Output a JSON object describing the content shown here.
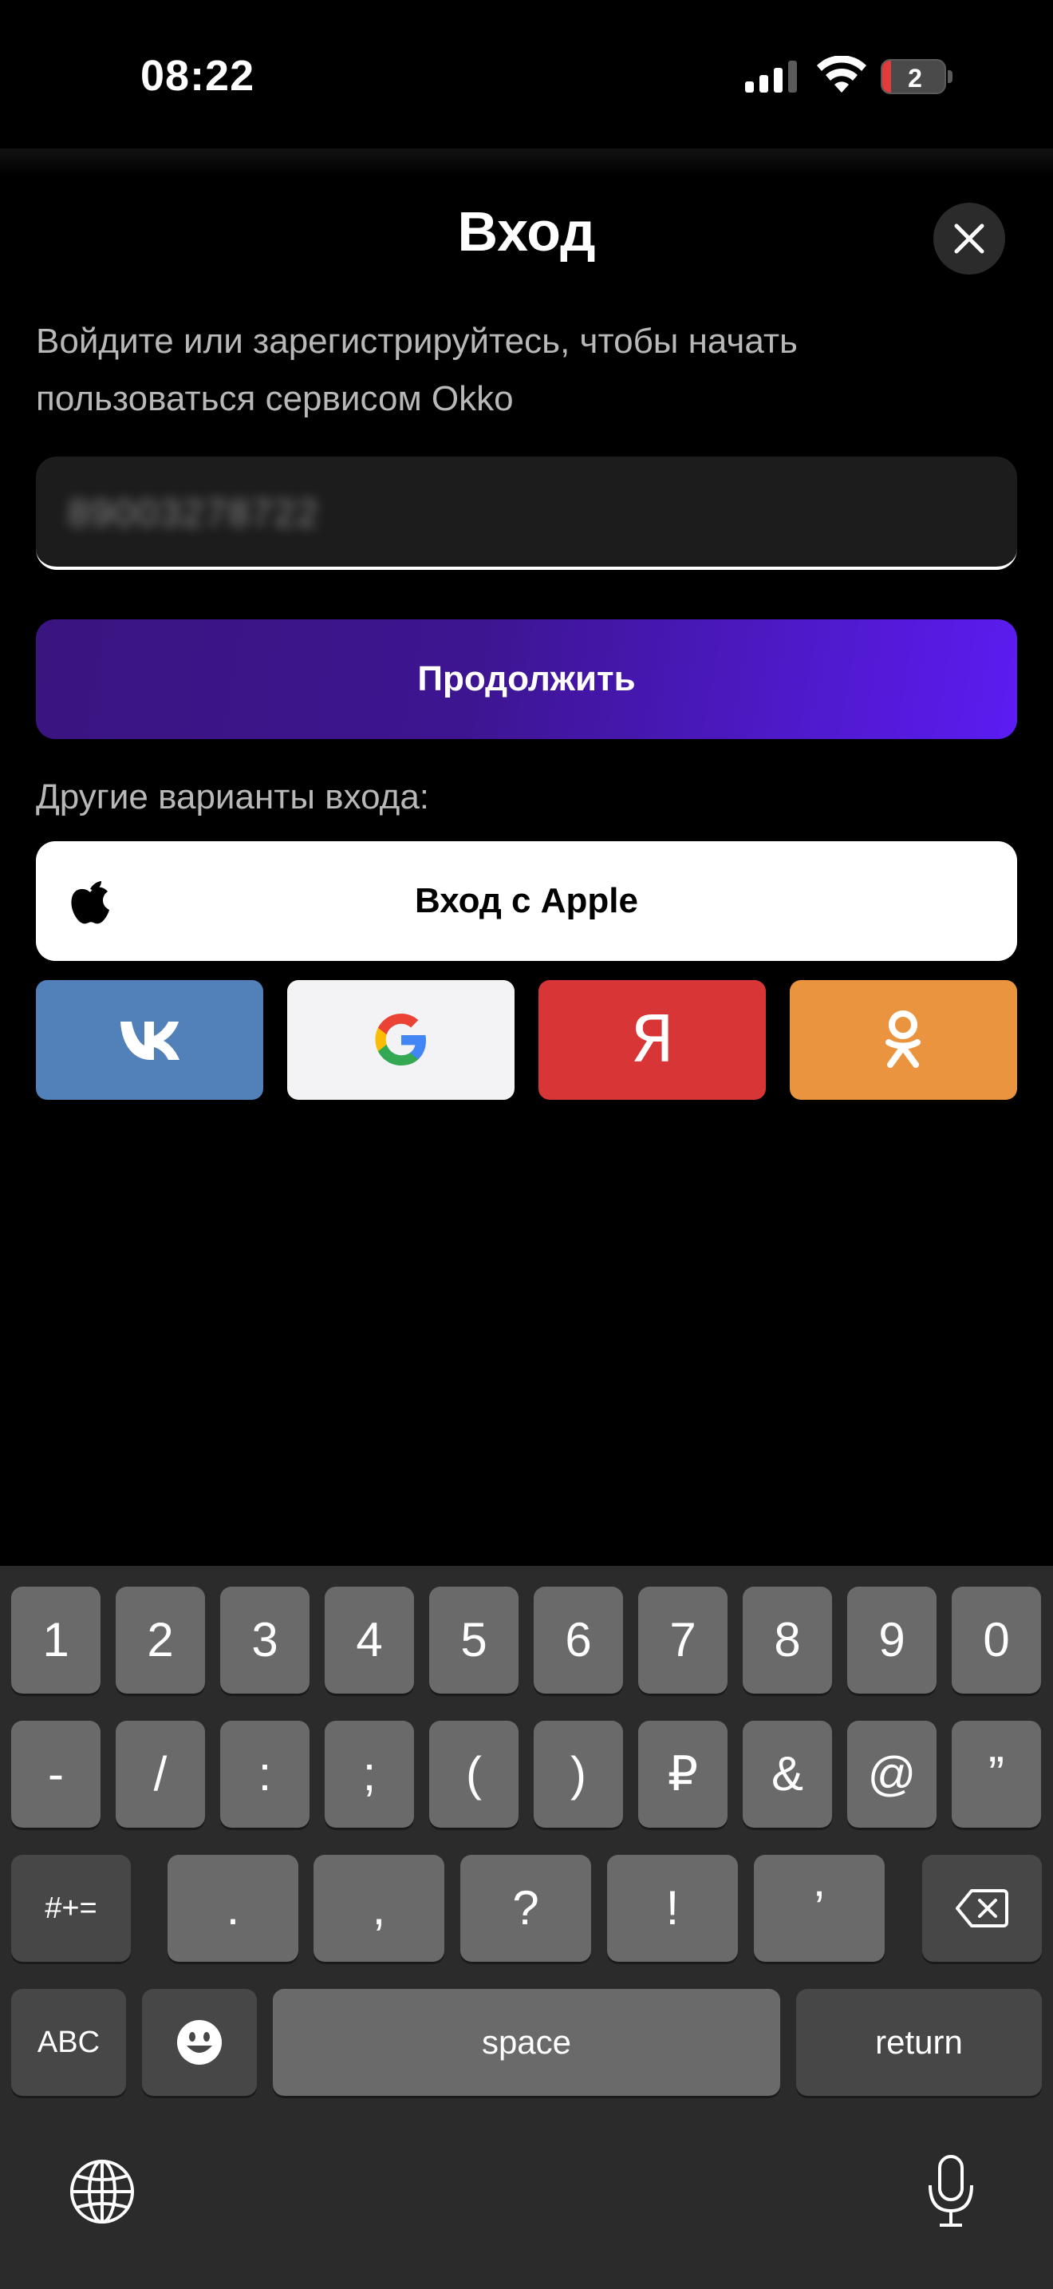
{
  "status_bar": {
    "time": "08:22",
    "battery_level": "2",
    "icons": [
      "cellular-signal-icon",
      "wifi-icon",
      "battery-icon"
    ]
  },
  "header": {
    "title": "Вход",
    "close_icon": "close-icon"
  },
  "form": {
    "subtitle": "Войдите или зарегистрируйтесь, чтобы начать пользоваться сервисом Okko",
    "phone_value": "89003278722",
    "continue_label": "Продолжить"
  },
  "other_options": {
    "label": "Другие варианты входа:",
    "apple_label": "Вход с Apple",
    "providers": [
      {
        "name": "vk",
        "icon": "vk-logo-icon",
        "color": "#5181b8"
      },
      {
        "name": "google",
        "icon": "google-logo-icon",
        "color": "#f3f3f5"
      },
      {
        "name": "yandex",
        "icon": "yandex-logo-icon",
        "letter": "Я",
        "color": "#d83636"
      },
      {
        "name": "odnoklassniki",
        "icon": "ok-logo-icon",
        "color": "#eb943f"
      }
    ]
  },
  "keyboard": {
    "row1": [
      "1",
      "2",
      "3",
      "4",
      "5",
      "6",
      "7",
      "8",
      "9",
      "0"
    ],
    "row2": [
      "-",
      "/",
      ":",
      ";",
      "(",
      ")",
      "₽",
      "&",
      "@",
      "”"
    ],
    "row3": {
      "symbols_key": "#+=",
      "keys": [
        ".",
        ",",
        "?",
        "!",
        "’"
      ],
      "delete_icon": "delete-icon"
    },
    "row4": {
      "abc_key": "ABC",
      "emoji_icon": "emoji-icon",
      "space_label": "space",
      "return_label": "return"
    },
    "bottom": {
      "globe_icon": "globe-icon",
      "mic_icon": "microphone-icon"
    }
  },
  "colors": {
    "accent_start": "#3a1580",
    "accent_end": "#5b1cf2",
    "background": "#000000"
  }
}
